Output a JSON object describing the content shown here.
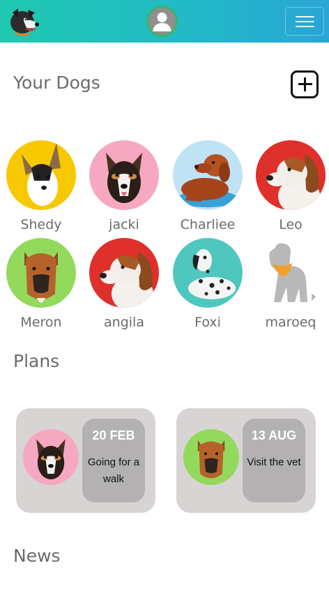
{
  "navbar": {
    "logo_icon": "dog-logo-icon",
    "avatar_icon": "user-avatar-icon",
    "menu_icon": "hamburger-icon",
    "colors": {
      "gradient_start": "#1fc8b0",
      "gradient_end": "#2aa5d6",
      "avatar_ring": "#3bb36a"
    }
  },
  "your_dogs": {
    "title": "Your Dogs",
    "add_icon": "plus-square-icon",
    "dogs": [
      {
        "name": "Shedy",
        "bg": "#f7c800"
      },
      {
        "name": "jacki",
        "bg": "#f6a8c0"
      },
      {
        "name": "Charliee",
        "bg": "#bfe3f5"
      },
      {
        "name": "Leo",
        "bg": "#e0302b"
      },
      {
        "name": "Meron",
        "bg": "#93d95c"
      },
      {
        "name": "angila",
        "bg": "#e0302b"
      },
      {
        "name": "Foxi",
        "bg": "#4fc7bf"
      },
      {
        "name": "maroeq",
        "bg": "#ffffff"
      }
    ]
  },
  "plans": {
    "title": "Plans",
    "items": [
      {
        "date": "20 FEB",
        "text": "Going for a walk",
        "bg": "#f6a8c0"
      },
      {
        "date": "13 AUG",
        "text": "Visit the vet",
        "bg": "#93d95c"
      }
    ]
  },
  "news": {
    "title": "News"
  }
}
